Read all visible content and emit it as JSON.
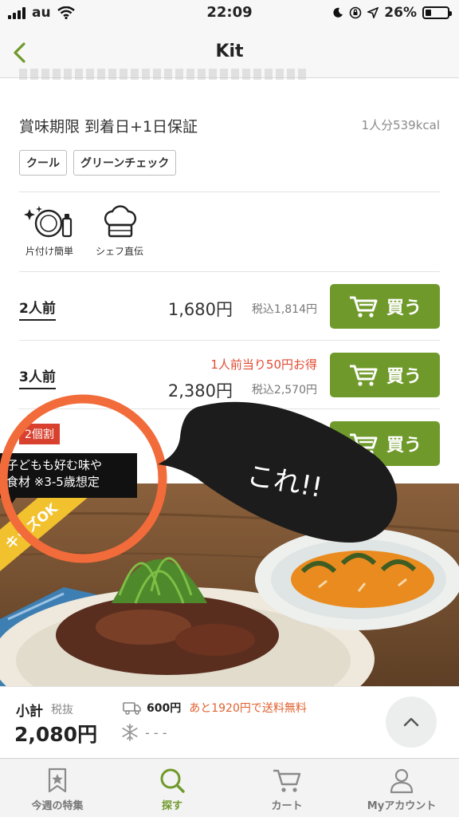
{
  "status_bar": {
    "carrier": "au",
    "time": "22:09",
    "battery": "26%",
    "battery_level": 0.26
  },
  "nav": {
    "title": "Kit"
  },
  "info": {
    "expiry": "賞味期限 到着日+1日保証",
    "kcal": "1人分539kcal",
    "tags": [
      "クール",
      "グリーンチェック"
    ]
  },
  "features": [
    {
      "label": "片付け簡単",
      "icon": "dish-clean-icon"
    },
    {
      "label": "シェフ直伝",
      "icon": "chef-hat-icon"
    }
  ],
  "options": [
    {
      "servings": "2人前",
      "price": "1,680円",
      "tax_in": "税込1,814円",
      "buy": "買う"
    },
    {
      "servings": "3人前",
      "promo": "1人前当り50円お得",
      "price": "2,380円",
      "tax_in": "税込2,570円",
      "buy": "買う"
    },
    {
      "badge": "2個割",
      "buy": "買う"
    }
  ],
  "tooltip": {
    "line1": "子どもも好む味や",
    "line2": "食材 ※3-5歳想定"
  },
  "ribbon": "キッズOK",
  "annotation": {
    "text": "これ!!",
    "color": "#f26b3a"
  },
  "subtotal": {
    "label": "小計",
    "tax_note": "税抜",
    "amount": "2,080円",
    "shipping_fee": "600円",
    "shipping_note": "あと1920円で送料無料",
    "cool_fee": "- - -"
  },
  "tabbar": [
    {
      "label": "今週の特集",
      "icon": "star-bookmark-icon",
      "active": false
    },
    {
      "label": "探す",
      "icon": "search-icon",
      "active": true
    },
    {
      "label": "カート",
      "icon": "cart-icon",
      "active": false
    },
    {
      "label": "Myアカウント",
      "icon": "person-icon",
      "active": false
    }
  ],
  "colors": {
    "accent_green": "#6f9a2b",
    "promo_red": "#e04b32",
    "badge_red": "#d9412f",
    "ribbon_yellow": "#f2c12e"
  }
}
